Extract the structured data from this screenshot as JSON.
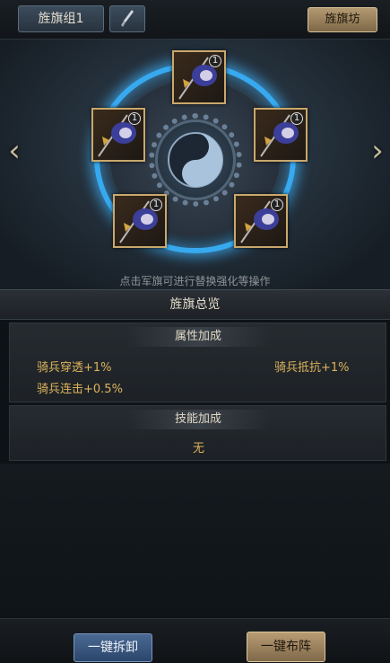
{
  "header": {
    "group_tab": "旌旗组1",
    "workshop_button": "旌旗坊"
  },
  "flags": [
    {
      "count": "1"
    },
    {
      "count": "1"
    },
    {
      "count": "1"
    },
    {
      "count": "1"
    },
    {
      "count": "1"
    }
  ],
  "hint": "点击军旗可进行替换强化等操作",
  "overview": {
    "title": "旌旗总览",
    "attributes": {
      "title": "属性加成",
      "stats": [
        "骑兵穿透+1%",
        "骑兵抵抗+1%",
        "骑兵连击+0.5%"
      ]
    },
    "skills": {
      "title": "技能加成",
      "value": "无"
    }
  },
  "buttons": {
    "dismount": "一键拆卸",
    "deploy": "一键布阵"
  },
  "colors": {
    "accent_gold": "#dcb35b",
    "ring_blue": "#37a9ef",
    "slot_border": "#c9a86c"
  }
}
